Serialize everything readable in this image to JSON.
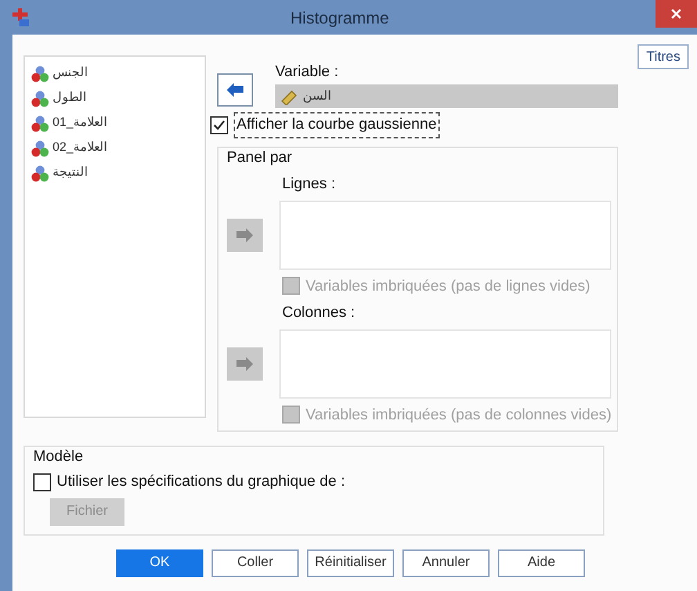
{
  "window": {
    "title": "Histogramme"
  },
  "variables": [
    {
      "label": "الجنس"
    },
    {
      "label": "الطول"
    },
    {
      "label": "العلامة_01"
    },
    {
      "label": "العلامة_02"
    },
    {
      "label": "النتيجة"
    }
  ],
  "variable": {
    "label": "Variable :",
    "value": "السن"
  },
  "titles_button": "Titres",
  "gaussian": {
    "label": "Afficher la courbe gaussienne",
    "checked": true
  },
  "panel": {
    "title": "Panel par",
    "rows": {
      "label": "Lignes :",
      "nested": {
        "label": "Variables imbriquées (pas de lignes vides)",
        "checked": false,
        "disabled": true
      }
    },
    "columns": {
      "label": "Colonnes :",
      "nested": {
        "label": "Variables imbriquées (pas de colonnes vides)",
        "checked": false,
        "disabled": true
      }
    }
  },
  "model": {
    "title": "Modèle",
    "use": {
      "label": "Utiliser les spécifications du graphique de :",
      "checked": false
    },
    "file_button": {
      "label": "Fichier",
      "disabled": true
    }
  },
  "buttons": [
    {
      "label": "OK",
      "kind": "primary"
    },
    {
      "label": "Coller",
      "kind": "normal"
    },
    {
      "label": "Réinitialiser",
      "kind": "normal"
    },
    {
      "label": "Annuler",
      "kind": "normal"
    },
    {
      "label": "Aide",
      "kind": "normal"
    }
  ]
}
